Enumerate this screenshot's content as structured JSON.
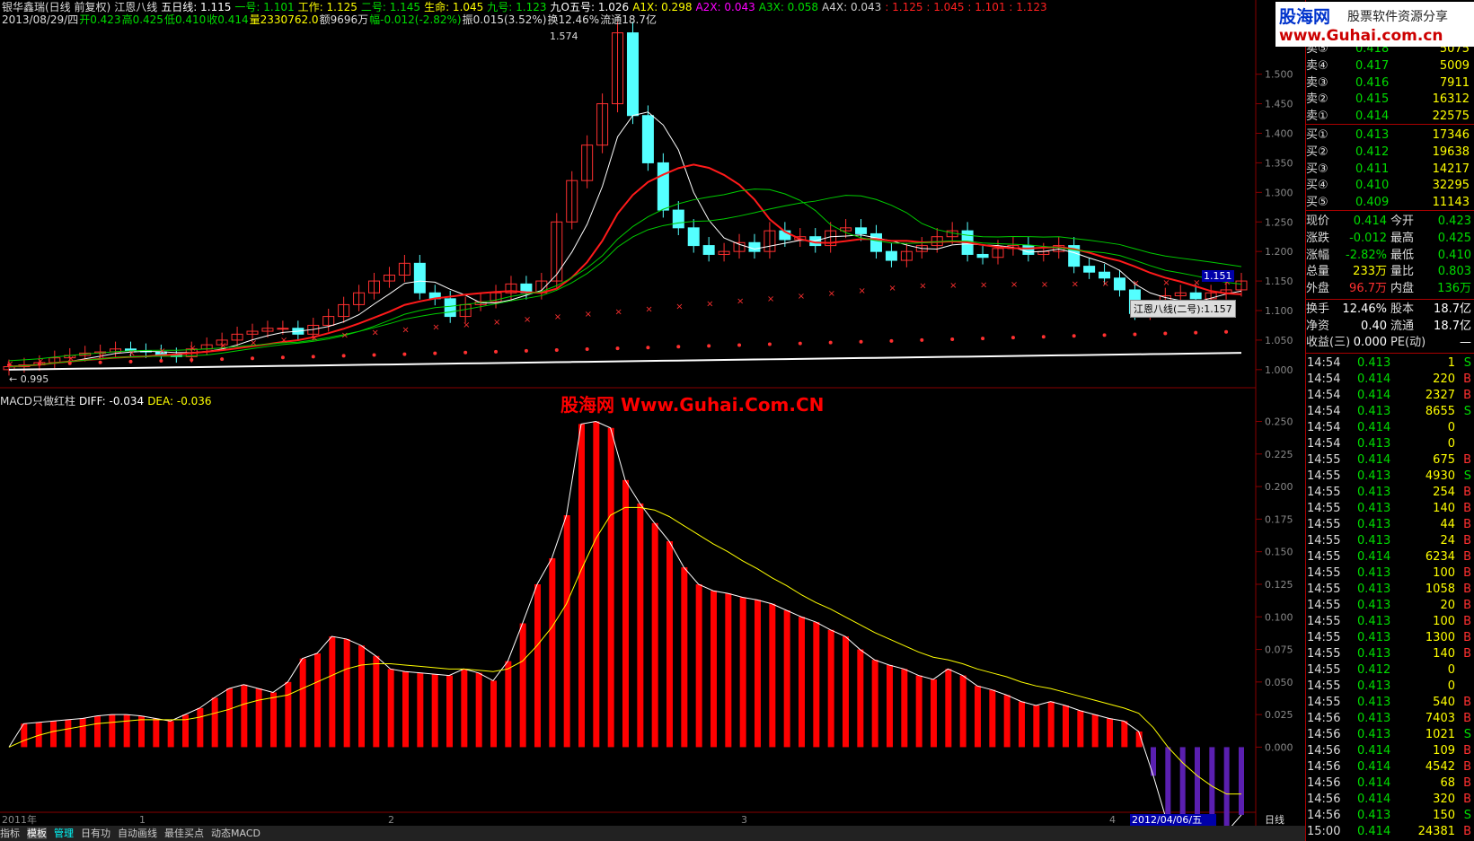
{
  "header1": {
    "title": "银华鑫瑞(日线 前复权)",
    "indicator": "江恩八线",
    "wu": "五日线: 1.115",
    "items": [
      {
        "t": "一号: 1.101",
        "c": "#00dd00"
      },
      {
        "t": "工作: 1.125",
        "c": "#ffff00"
      },
      {
        "t": "二号: 1.145",
        "c": "#00dd00"
      },
      {
        "t": "生命: 1.045",
        "c": "#ffff00"
      },
      {
        "t": "九号: 1.123",
        "c": "#00dd00"
      },
      {
        "t": "九O五号: 1.026",
        "c": "#ffffff"
      },
      {
        "t": "A1X: 0.298",
        "c": "#ffff00"
      },
      {
        "t": "A2X: 0.043",
        "c": "#ff00ff"
      },
      {
        "t": "A3X: 0.058",
        "c": "#00dd00"
      },
      {
        "t": "A4X: 0.043",
        "c": "#cccccc"
      },
      {
        "t": ": 1.125 : 1.045 : 1.101 : 1.123",
        "c": "#ff2020"
      }
    ]
  },
  "header2": {
    "date": "2013/08/29/四",
    "open": "开0.423",
    "high": "高0.425",
    "low": "低0.410",
    "close": "收0.414",
    "vol": "量2330762.0",
    "amt": "额9696万",
    "chg": "幅-0.012(-2.82%)",
    "amp": "振0.015(3.52%)",
    "turn": "换12.46%",
    "float": "流通18.7亿"
  },
  "main_chart": {
    "peak_label": "1.574",
    "low_label": "0.995",
    "current_tag": "1.151",
    "tooltip": "江恩八线(二号):1.157",
    "y_ticks": [
      "1.500",
      "1.450",
      "1.400",
      "1.350",
      "1.300",
      "1.250",
      "1.200",
      "1.150",
      "1.100",
      "1.050",
      "1.000"
    ]
  },
  "macd": {
    "title": "MACD只做红柱",
    "diff": "DIFF: -0.034",
    "dea": "DEA: -0.036",
    "watermark": "股海网 Www.Guhai.Com.CN",
    "y_ticks": [
      "0.250",
      "0.225",
      "0.200",
      "0.175",
      "0.150",
      "0.125",
      "0.100",
      "0.075",
      "0.050",
      "0.025",
      "0.000"
    ]
  },
  "xaxis": {
    "labels": [
      "2011年",
      "1",
      "2",
      "3",
      "4"
    ],
    "cursor_date": "2012/04/06/五",
    "period": "日线"
  },
  "tabs": [
    "指标",
    "模板",
    "管理",
    "日有功",
    "自动画线",
    "最佳买点",
    "动态MACD"
  ],
  "logo": {
    "brand": "股海网",
    "slogan": "股票软件资源分享",
    "url": "www.Guhai.com.cn"
  },
  "orderbook": {
    "sells": [
      {
        "label": "卖⑤",
        "price": "0.418",
        "vol": "5075"
      },
      {
        "label": "卖④",
        "price": "0.417",
        "vol": "5009"
      },
      {
        "label": "卖③",
        "price": "0.416",
        "vol": "7911"
      },
      {
        "label": "卖②",
        "price": "0.415",
        "vol": "16312"
      },
      {
        "label": "卖①",
        "price": "0.414",
        "vol": "22575"
      }
    ],
    "buys": [
      {
        "label": "买①",
        "price": "0.413",
        "vol": "17346"
      },
      {
        "label": "买②",
        "price": "0.412",
        "vol": "19638"
      },
      {
        "label": "买③",
        "price": "0.411",
        "vol": "14217"
      },
      {
        "label": "买④",
        "price": "0.410",
        "vol": "32295"
      },
      {
        "label": "买⑤",
        "price": "0.409",
        "vol": "11143"
      }
    ]
  },
  "quote": [
    {
      "l1": "现价",
      "v1": "0.414",
      "c1": "#00dd00",
      "l2": "今开",
      "v2": "0.423",
      "c2": "#00dd00"
    },
    {
      "l1": "涨跌",
      "v1": "-0.012",
      "c1": "#00dd00",
      "l2": "最高",
      "v2": "0.425",
      "c2": "#00dd00"
    },
    {
      "l1": "涨幅",
      "v1": "-2.82%",
      "c1": "#00dd00",
      "l2": "最低",
      "v2": "0.410",
      "c2": "#00dd00"
    },
    {
      "l1": "总量",
      "v1": "233万",
      "c1": "#ffff00",
      "l2": "量比",
      "v2": "0.803",
      "c2": "#00dd00"
    },
    {
      "l1": "外盘",
      "v1": "96.7万",
      "c1": "#ff3030",
      "l2": "内盘",
      "v2": "136万",
      "c2": "#00dd00"
    }
  ],
  "quote2": [
    {
      "l1": "换手",
      "v1": "12.46%",
      "l2": "股本",
      "v2": "18.7亿"
    },
    {
      "l1": "净资",
      "v1": "0.40",
      "l2": "流通",
      "v2": "18.7亿"
    },
    {
      "l1": "收益(三)",
      "v1": "0.000",
      "l2": "PE(动)",
      "v2": "—"
    }
  ],
  "ticks": [
    {
      "t": "14:54",
      "p": "0.413",
      "v": "1",
      "s": "S"
    },
    {
      "t": "14:54",
      "p": "0.414",
      "v": "220",
      "s": "B"
    },
    {
      "t": "14:54",
      "p": "0.414",
      "v": "2327",
      "s": "B"
    },
    {
      "t": "14:54",
      "p": "0.413",
      "v": "8655",
      "s": "S"
    },
    {
      "t": "14:54",
      "p": "0.414",
      "v": "0",
      "s": ""
    },
    {
      "t": "14:54",
      "p": "0.413",
      "v": "0",
      "s": ""
    },
    {
      "t": "14:55",
      "p": "0.414",
      "v": "675",
      "s": "B"
    },
    {
      "t": "14:55",
      "p": "0.413",
      "v": "4930",
      "s": "S"
    },
    {
      "t": "14:55",
      "p": "0.413",
      "v": "254",
      "s": "B"
    },
    {
      "t": "14:55",
      "p": "0.413",
      "v": "140",
      "s": "B"
    },
    {
      "t": "14:55",
      "p": "0.413",
      "v": "44",
      "s": "B"
    },
    {
      "t": "14:55",
      "p": "0.413",
      "v": "24",
      "s": "B"
    },
    {
      "t": "14:55",
      "p": "0.414",
      "v": "6234",
      "s": "B"
    },
    {
      "t": "14:55",
      "p": "0.413",
      "v": "100",
      "s": "B"
    },
    {
      "t": "14:55",
      "p": "0.413",
      "v": "1058",
      "s": "B"
    },
    {
      "t": "14:55",
      "p": "0.413",
      "v": "20",
      "s": "B"
    },
    {
      "t": "14:55",
      "p": "0.413",
      "v": "100",
      "s": "B"
    },
    {
      "t": "14:55",
      "p": "0.413",
      "v": "1300",
      "s": "B"
    },
    {
      "t": "14:55",
      "p": "0.413",
      "v": "140",
      "s": "B"
    },
    {
      "t": "14:55",
      "p": "0.412",
      "v": "0",
      "s": ""
    },
    {
      "t": "14:55",
      "p": "0.413",
      "v": "0",
      "s": ""
    },
    {
      "t": "14:55",
      "p": "0.413",
      "v": "540",
      "s": "B"
    },
    {
      "t": "14:56",
      "p": "0.413",
      "v": "7403",
      "s": "B"
    },
    {
      "t": "14:56",
      "p": "0.413",
      "v": "1021",
      "s": "S"
    },
    {
      "t": "14:56",
      "p": "0.414",
      "v": "109",
      "s": "B"
    },
    {
      "t": "14:56",
      "p": "0.414",
      "v": "4542",
      "s": "B"
    },
    {
      "t": "14:56",
      "p": "0.414",
      "v": "68",
      "s": "B"
    },
    {
      "t": "14:56",
      "p": "0.414",
      "v": "320",
      "s": "B"
    },
    {
      "t": "14:56",
      "p": "0.413",
      "v": "150",
      "s": "S"
    },
    {
      "t": "15:00",
      "p": "0.414",
      "v": "24381",
      "s": "B"
    }
  ],
  "chart_data": [
    {
      "type": "candlestick",
      "ylim": [
        0.98,
        1.58
      ],
      "closes": [
        1.005,
        1.008,
        1.012,
        1.02,
        1.024,
        1.028,
        1.03,
        1.035,
        1.032,
        1.03,
        1.025,
        1.022,
        1.035,
        1.042,
        1.05,
        1.06,
        1.065,
        1.07,
        1.07,
        1.06,
        1.075,
        1.09,
        1.11,
        1.13,
        1.15,
        1.16,
        1.18,
        1.13,
        1.12,
        1.09,
        1.11,
        1.115,
        1.13,
        1.145,
        1.13,
        1.15,
        1.25,
        1.32,
        1.38,
        1.45,
        1.57,
        1.43,
        1.35,
        1.27,
        1.24,
        1.21,
        1.195,
        1.2,
        1.215,
        1.2,
        1.235,
        1.22,
        1.225,
        1.21,
        1.235,
        1.24,
        1.23,
        1.2,
        1.185,
        1.2,
        1.21,
        1.225,
        1.235,
        1.195,
        1.19,
        1.205,
        1.21,
        1.195,
        1.2,
        1.21,
        1.175,
        1.165,
        1.155,
        1.135,
        1.095,
        1.1,
        1.125,
        1.13,
        1.12,
        1.13,
        1.135,
        1.15
      ],
      "series": [
        {
          "name": "一号",
          "color": "#00cc00"
        },
        {
          "name": "二号",
          "color": "#00cc00"
        },
        {
          "name": "生命",
          "color": "#ff1a1a"
        },
        {
          "name": "九O五号",
          "color": "#ffffff"
        }
      ]
    },
    {
      "type": "bar",
      "ylim": [
        -0.05,
        0.26
      ],
      "values": [
        0.0,
        0.018,
        0.019,
        0.02,
        0.021,
        0.022,
        0.024,
        0.025,
        0.025,
        0.024,
        0.022,
        0.02,
        0.025,
        0.03,
        0.038,
        0.045,
        0.048,
        0.045,
        0.042,
        0.05,
        0.068,
        0.072,
        0.085,
        0.083,
        0.078,
        0.07,
        0.06,
        0.058,
        0.057,
        0.056,
        0.055,
        0.06,
        0.057,
        0.051,
        0.066,
        0.095,
        0.125,
        0.145,
        0.178,
        0.248,
        0.25,
        0.245,
        0.205,
        0.187,
        0.172,
        0.158,
        0.138,
        0.125,
        0.12,
        0.118,
        0.115,
        0.113,
        0.11,
        0.105,
        0.1,
        0.096,
        0.09,
        0.085,
        0.075,
        0.067,
        0.063,
        0.06,
        0.055,
        0.052,
        0.06,
        0.055,
        0.047,
        0.044,
        0.04,
        0.035,
        0.032,
        0.035,
        0.032,
        0.028,
        0.025,
        0.022,
        0.02,
        0.012,
        -0.022,
        -0.06,
        -0.073,
        -0.07,
        -0.068,
        -0.065,
        -0.052
      ],
      "dea": [
        0.0,
        0.005,
        0.009,
        0.012,
        0.014,
        0.016,
        0.018,
        0.019,
        0.02,
        0.021,
        0.021,
        0.021,
        0.021,
        0.023,
        0.026,
        0.029,
        0.033,
        0.036,
        0.038,
        0.04,
        0.045,
        0.05,
        0.055,
        0.06,
        0.063,
        0.064,
        0.064,
        0.063,
        0.062,
        0.061,
        0.06,
        0.06,
        0.059,
        0.058,
        0.06,
        0.066,
        0.078,
        0.092,
        0.11,
        0.136,
        0.16,
        0.178,
        0.184,
        0.184,
        0.182,
        0.177,
        0.17,
        0.163,
        0.156,
        0.15,
        0.143,
        0.137,
        0.13,
        0.124,
        0.117,
        0.111,
        0.106,
        0.1,
        0.094,
        0.088,
        0.083,
        0.078,
        0.073,
        0.069,
        0.067,
        0.064,
        0.06,
        0.057,
        0.054,
        0.05,
        0.047,
        0.045,
        0.042,
        0.039,
        0.036,
        0.033,
        0.03,
        0.026,
        0.015,
        0.0,
        -0.012,
        -0.022,
        -0.03,
        -0.036,
        -0.036
      ]
    }
  ]
}
